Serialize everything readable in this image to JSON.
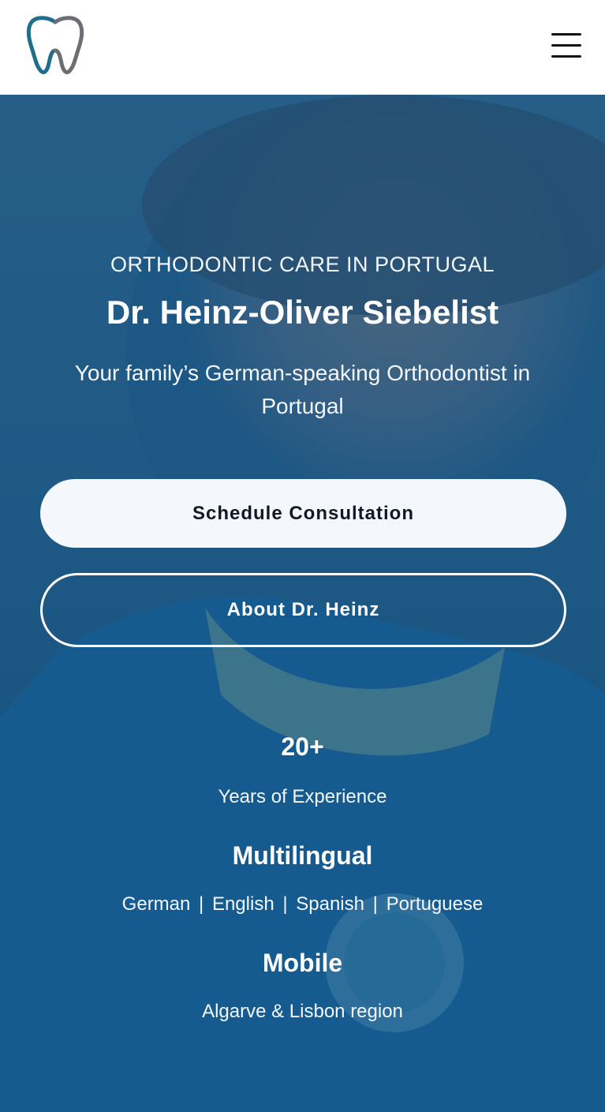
{
  "header": {
    "logo_icon": "tooth-icon",
    "menu_icon": "hamburger-menu-icon"
  },
  "hero": {
    "eyebrow": "ORTHODONTIC CARE IN PORTUGAL",
    "title": "Dr. Heinz-Oliver Siebelist",
    "subtitle": "Your family’s German-speaking Orthodontist in Portugal",
    "primary_button": "Schedule Consultation",
    "secondary_button": "About Dr. Heinz"
  },
  "stats": {
    "experience_value": "20+",
    "experience_label": "Years of Experience",
    "languages_title": "Multilingual",
    "languages": [
      "German",
      "English",
      "Spanish",
      "Portuguese"
    ],
    "separator": "|",
    "mobile_title": "Mobile",
    "mobile_label": "Algarve & Lisbon region"
  },
  "colors": {
    "brand_blue": "#1d5a82",
    "logo_teal": "#1f6e8c",
    "logo_grey": "#6b6f74"
  }
}
